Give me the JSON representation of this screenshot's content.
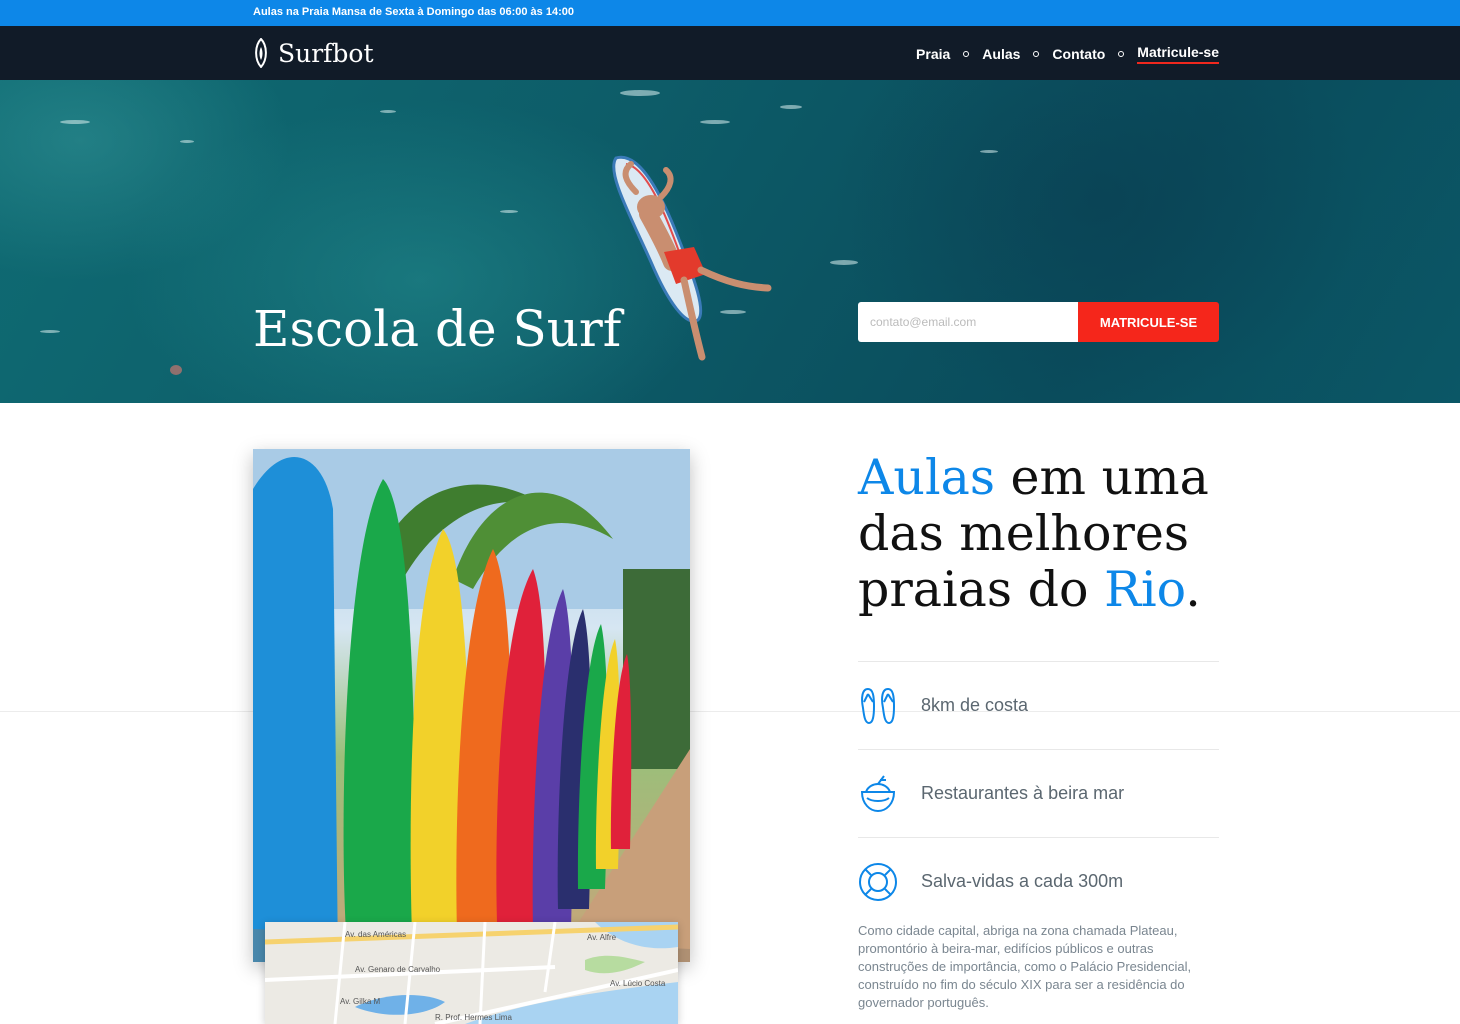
{
  "topbar": {
    "text": "Aulas na Praia Mansa de Sexta à Domingo das 06:00 às 14:00"
  },
  "nav": {
    "logo_text": "Surfbot",
    "items": [
      "Praia",
      "Aulas",
      "Contato",
      "Matricule-se"
    ]
  },
  "hero": {
    "title": "Escola de Surf",
    "email_placeholder": "contato@email.com",
    "cta_label": "MATRICULE-SE"
  },
  "map": {
    "streets": [
      "Av. das Américas",
      "Av. Genaro de Carvalho",
      "R. Prof. Hermes Lima",
      "Av. Lúcio Costa",
      "Av. Gilka M",
      "Av. Alfre"
    ]
  },
  "section": {
    "headline_a": "Aulas",
    "headline_b": " em uma das melhores praias do ",
    "headline_c": "Rio",
    "headline_d": ".",
    "features": [
      {
        "icon": "flip-flops-icon",
        "text": "8km de costa"
      },
      {
        "icon": "coconut-drink-icon",
        "text": "Restaurantes à beira mar"
      },
      {
        "icon": "lifebuoy-icon",
        "text": "Salva-vidas a cada 300m"
      }
    ],
    "paragraph": "Como cidade capital, abriga na zona chamada Plateau, promontório à beira-mar, edifícios públicos e outras construções de importância, como o Palácio Presidencial, construído no fim do século XIX para ser a residência do governador português."
  },
  "colors": {
    "accent": "#0d87e8",
    "cta": "#f5261b",
    "nav_bg": "#111b28"
  }
}
